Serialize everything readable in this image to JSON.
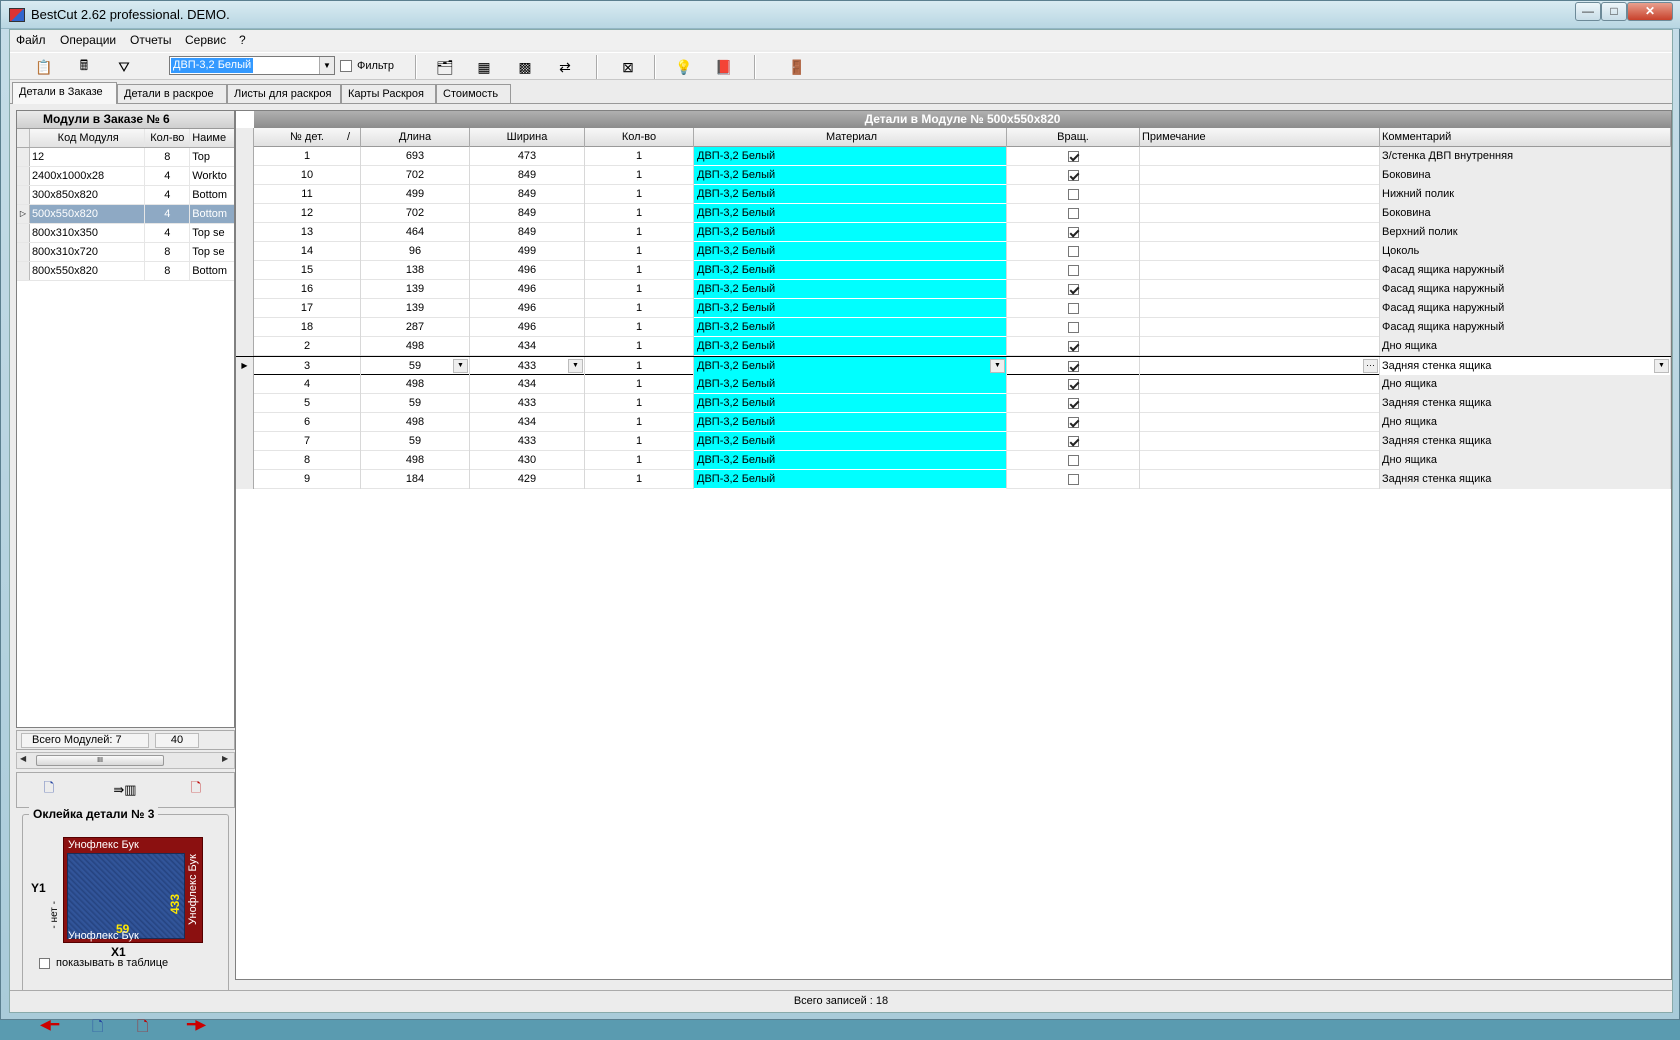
{
  "window": {
    "title": "BestCut 2.62 professional.    DEMO.",
    "min": "—",
    "max": "□",
    "close": "✕"
  },
  "menu": [
    "Файл",
    "Операции",
    "Отчеты",
    "Сервис",
    "?"
  ],
  "toolbar": {
    "material_combo": "ДВП-3,2 Белый",
    "filter_label": "Фильтр",
    "filter_checked": false
  },
  "tabs": [
    "Детали в Заказе",
    "Детали в раскрое",
    "Листы для раскроя",
    "Карты Раскроя",
    "Стоимость"
  ],
  "active_tab": 0,
  "modules": {
    "title": "Модули в Заказе № 6",
    "columns": [
      "Код Модуля",
      "Кол-во",
      "Наиме"
    ],
    "rows": [
      {
        "code": "12",
        "qty": "8",
        "name": "Top"
      },
      {
        "code": "2400x1000x28",
        "qty": "4",
        "name": "Workto"
      },
      {
        "code": "300x850x820",
        "qty": "4",
        "name": "Bottom"
      },
      {
        "code": "500x550x820",
        "qty": "4",
        "name": "Bottom",
        "selected": true
      },
      {
        "code": "800x310x350",
        "qty": "4",
        "name": "Top se"
      },
      {
        "code": "800x310x720",
        "qty": "8",
        "name": "Top se"
      },
      {
        "code": "800x550x820",
        "qty": "8",
        "name": "Bottom"
      }
    ],
    "footer_label": "Всего Модулей: 7",
    "footer_total": "40"
  },
  "edging": {
    "title": "Оклейка детали № 3",
    "top": "Унофлекс Бук",
    "bottom": "Унофлекс Бук",
    "right": "Унофлекс Бук",
    "left": "- нет -",
    "width": "59",
    "height": "433",
    "y_label": "Y1",
    "x_label": "X1",
    "show_in_table": "показывать в таблице"
  },
  "details": {
    "title": "Детали в Модуле № 500x550x820",
    "columns": [
      "№ дет.",
      "Длина",
      "Ширина",
      "Кол-во",
      "Материал",
      "Вращ.",
      "Примечание",
      "Комментарий"
    ],
    "sort_mark": "/",
    "rows": [
      {
        "n": "1",
        "l": "693",
        "w": "473",
        "q": "1",
        "m": "ДВП-3,2 Белый",
        "rot": true,
        "note": "",
        "comment": "З/стенка ДВП внутренняя"
      },
      {
        "n": "10",
        "l": "702",
        "w": "849",
        "q": "1",
        "m": "ДВП-3,2 Белый",
        "rot": true,
        "note": "",
        "comment": "Боковина"
      },
      {
        "n": "11",
        "l": "499",
        "w": "849",
        "q": "1",
        "m": "ДВП-3,2 Белый",
        "rot": false,
        "note": "",
        "comment": "Нижний полик"
      },
      {
        "n": "12",
        "l": "702",
        "w": "849",
        "q": "1",
        "m": "ДВП-3,2 Белый",
        "rot": false,
        "note": "",
        "comment": "Боковина"
      },
      {
        "n": "13",
        "l": "464",
        "w": "849",
        "q": "1",
        "m": "ДВП-3,2 Белый",
        "rot": true,
        "note": "",
        "comment": "Верхний полик"
      },
      {
        "n": "14",
        "l": "96",
        "w": "499",
        "q": "1",
        "m": "ДВП-3,2 Белый",
        "rot": false,
        "note": "",
        "comment": "Цоколь"
      },
      {
        "n": "15",
        "l": "138",
        "w": "496",
        "q": "1",
        "m": "ДВП-3,2 Белый",
        "rot": false,
        "note": "",
        "comment": "Фасад ящика наружный"
      },
      {
        "n": "16",
        "l": "139",
        "w": "496",
        "q": "1",
        "m": "ДВП-3,2 Белый",
        "rot": true,
        "note": "",
        "comment": "Фасад ящика наружный"
      },
      {
        "n": "17",
        "l": "139",
        "w": "496",
        "q": "1",
        "m": "ДВП-3,2 Белый",
        "rot": false,
        "note": "",
        "comment": "Фасад ящика наружный"
      },
      {
        "n": "18",
        "l": "287",
        "w": "496",
        "q": "1",
        "m": "ДВП-3,2 Белый",
        "rot": false,
        "note": "",
        "comment": "Фасад ящика наружный"
      },
      {
        "n": "2",
        "l": "498",
        "w": "434",
        "q": "1",
        "m": "ДВП-3,2 Белый",
        "rot": true,
        "note": "",
        "comment": "Дно ящика"
      },
      {
        "n": "3",
        "l": "59",
        "w": "433",
        "q": "1",
        "m": "ДВП-3,2 Белый",
        "rot": true,
        "note": "",
        "comment": "Задняя стенка ящика",
        "current": true
      },
      {
        "n": "4",
        "l": "498",
        "w": "434",
        "q": "1",
        "m": "ДВП-3,2 Белый",
        "rot": true,
        "note": "",
        "comment": "Дно ящика"
      },
      {
        "n": "5",
        "l": "59",
        "w": "433",
        "q": "1",
        "m": "ДВП-3,2 Белый",
        "rot": true,
        "note": "",
        "comment": "Задняя стенка ящика"
      },
      {
        "n": "6",
        "l": "498",
        "w": "434",
        "q": "1",
        "m": "ДВП-3,2 Белый",
        "rot": true,
        "note": "",
        "comment": "Дно ящика"
      },
      {
        "n": "7",
        "l": "59",
        "w": "433",
        "q": "1",
        "m": "ДВП-3,2 Белый",
        "rot": true,
        "note": "",
        "comment": "Задняя стенка ящика"
      },
      {
        "n": "8",
        "l": "498",
        "w": "430",
        "q": "1",
        "m": "ДВП-3,2 Белый",
        "rot": false,
        "note": "",
        "comment": "Дно ящика"
      },
      {
        "n": "9",
        "l": "184",
        "w": "429",
        "q": "1",
        "m": "ДВП-3,2 Белый",
        "rot": false,
        "note": "",
        "comment": "Задняя стенка ящика"
      }
    ]
  },
  "status": "Всего записей : 18",
  "colors": {
    "material_cell": "#00ffff",
    "edge_band": "#8b1010",
    "selected_row": "#8ea9c4"
  }
}
